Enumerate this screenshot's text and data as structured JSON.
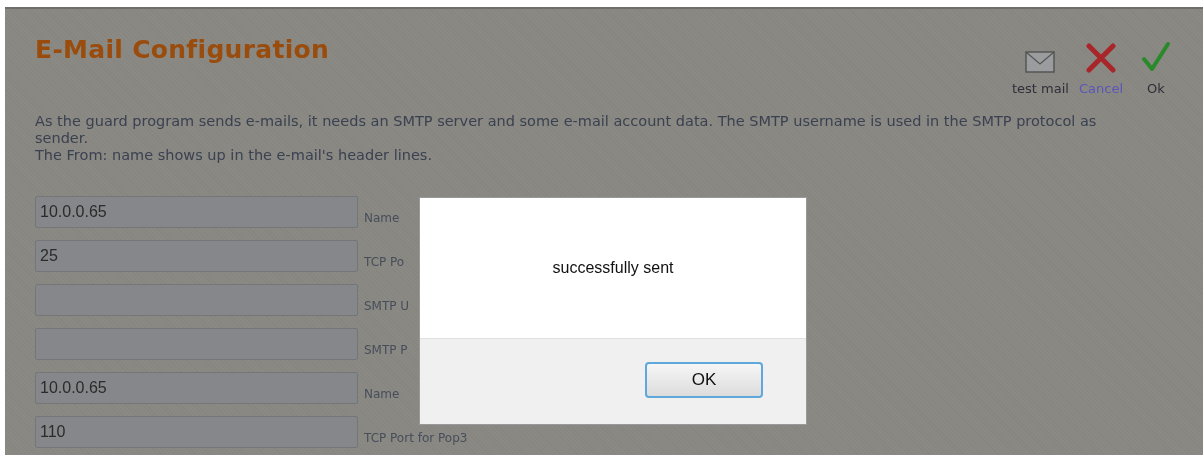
{
  "page": {
    "title": "E-Mail Configuration",
    "actions": [
      {
        "kind": "mail",
        "label": "test mail"
      },
      {
        "kind": "cancel",
        "label": "Cancel"
      },
      {
        "kind": "ok",
        "label": "Ok"
      }
    ],
    "description": [
      "As the guard program sends e-mails, it needs an SMTP server and some e-mail account data. The SMTP username is used in the SMTP protocol as sender.",
      "The From: name shows up in the e-mail's header lines."
    ],
    "fields": [
      {
        "value": "10.0.0.65",
        "label": "Name"
      },
      {
        "value": "25",
        "label": "TCP Po"
      },
      {
        "label": "SMTP U"
      },
      {
        "label": "SMTP P"
      },
      {
        "value": "10.0.0.65",
        "label": "Name"
      },
      {
        "value": "110",
        "label": "TCP Port for Pop3"
      }
    ]
  },
  "dialog": {
    "message": "successfully sent",
    "button": "OK"
  }
}
